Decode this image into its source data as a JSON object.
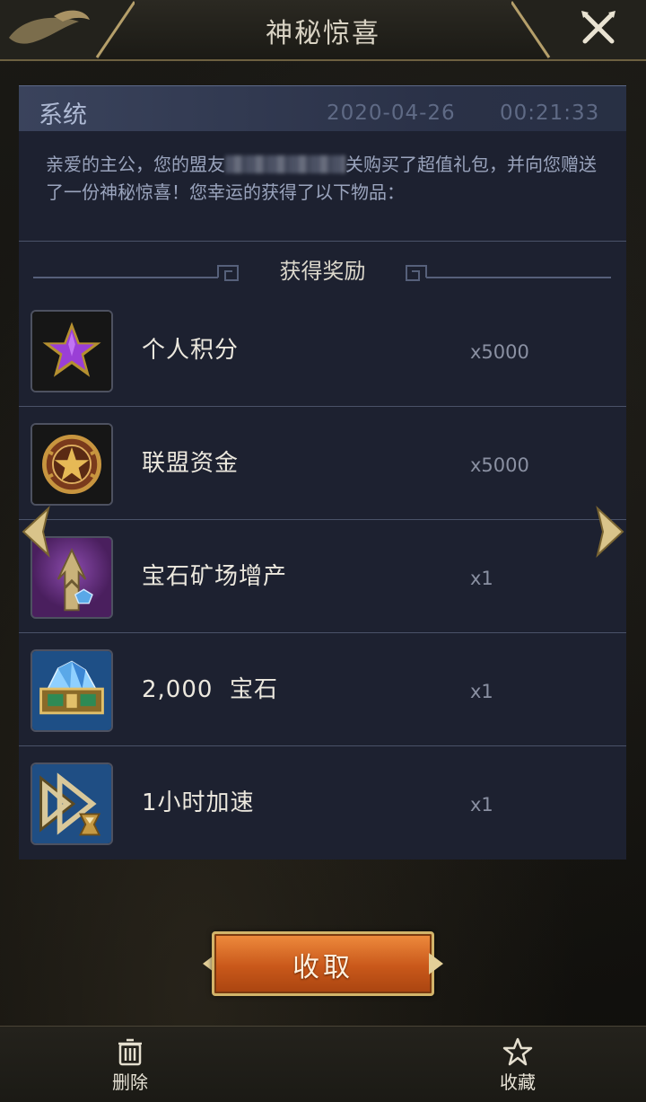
{
  "header": {
    "title": "神秘惊喜"
  },
  "mail": {
    "sender": "系统",
    "date": "2020-04-26",
    "time": "00:21:33",
    "message_part1": "亲爱的主公，您的盟友",
    "message_part2": "关购买了超值礼包，并向您赠送了一份神秘惊喜！您幸运的获得了以下物品："
  },
  "rewards": {
    "title": "获得奖励",
    "items": [
      {
        "name": "个人积分",
        "qty": "x5000",
        "icon": "purple-star-icon"
      },
      {
        "name": "联盟资金",
        "qty": "x5000",
        "icon": "alliance-badge-icon"
      },
      {
        "name": "宝石矿场增产",
        "qty": "x1",
        "icon": "gem-mine-boost-icon"
      },
      {
        "name": "2,000  宝石",
        "qty": "x1",
        "icon": "gem-chest-icon"
      },
      {
        "name": "1小时加速",
        "qty": "x1",
        "icon": "speedup-hourglass-icon"
      }
    ]
  },
  "actions": {
    "collect_label": "收取"
  },
  "bottom_bar": {
    "delete_label": "删除",
    "favorite_label": "收藏"
  },
  "colors": {
    "panel": "#1d2130",
    "accent_orange": "#c9581a",
    "gold": "#d2b46a"
  }
}
